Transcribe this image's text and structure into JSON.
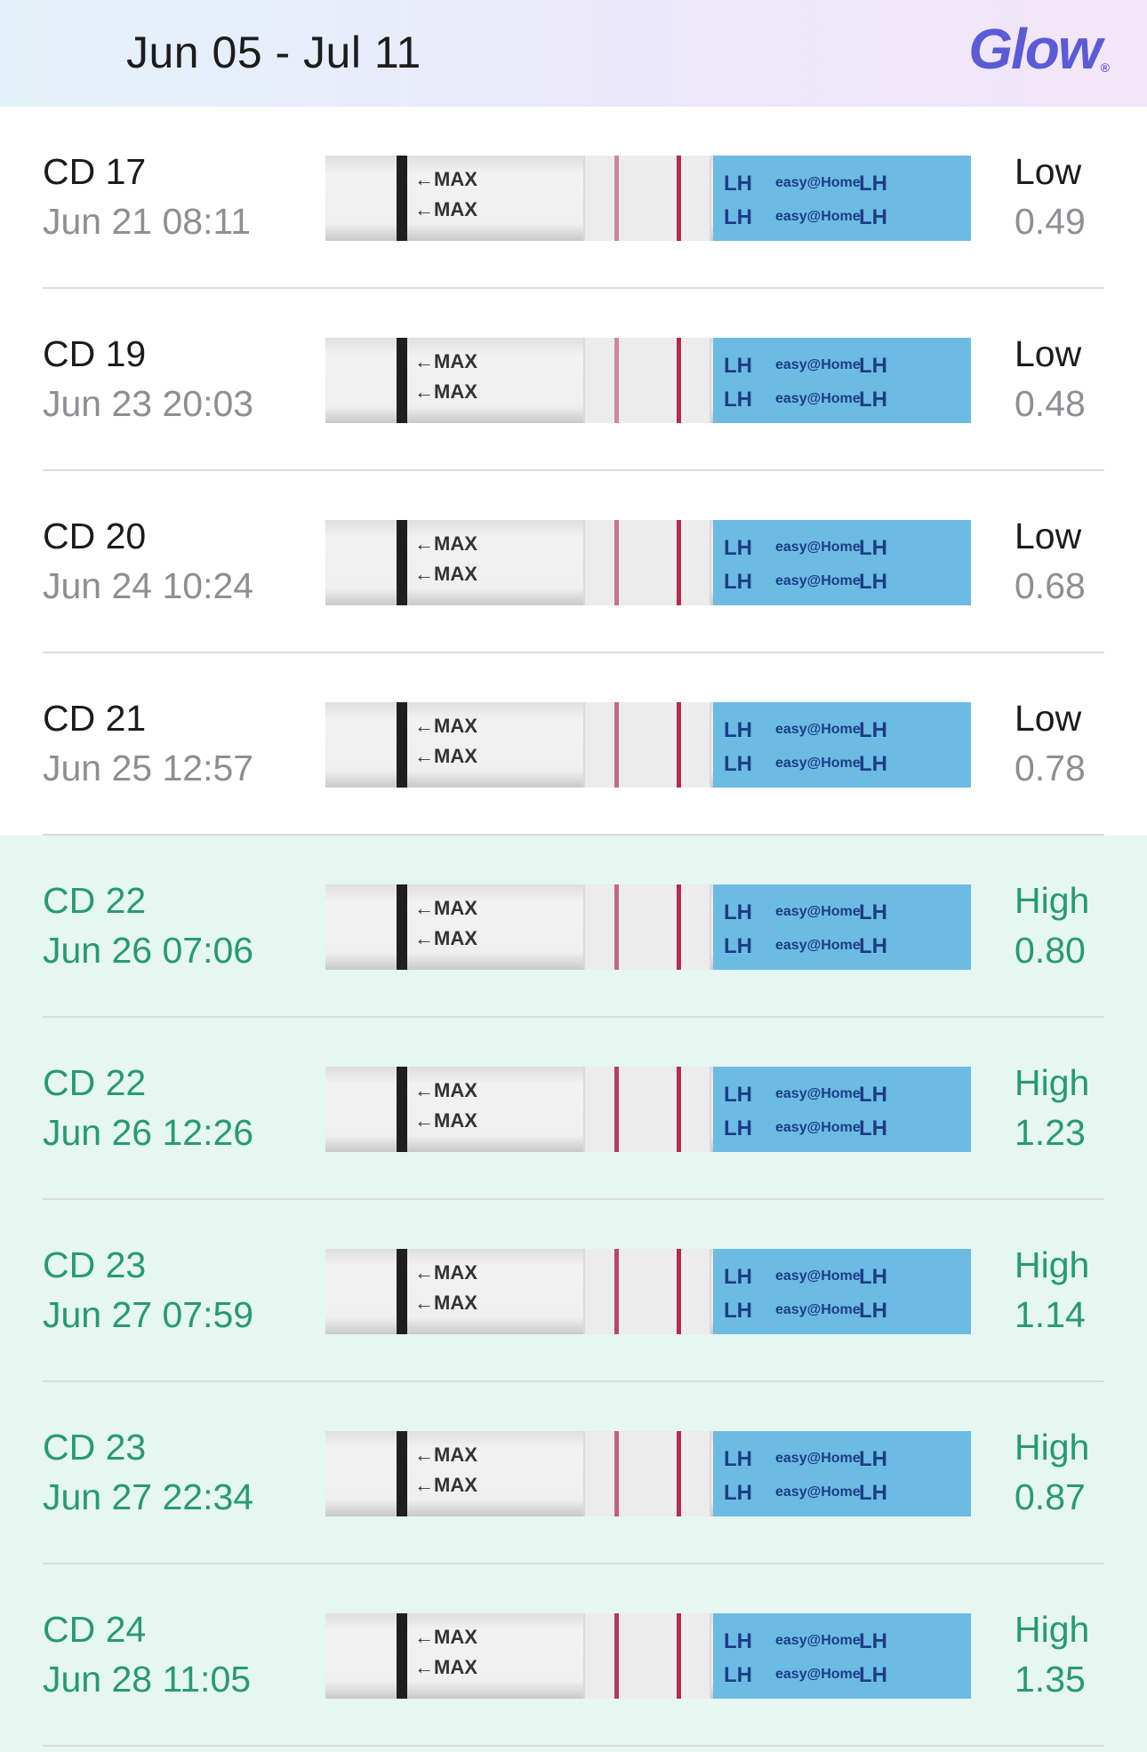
{
  "header": {
    "date_range": "Jun 05 - Jul 11",
    "brand": "Glow",
    "brand_mark": "®"
  },
  "strip_text": {
    "max": "←MAX",
    "lh": "LH",
    "brand_text": "easy@Home"
  },
  "colors": {
    "high_text": "#279a72",
    "low_label": "#1c1c1e",
    "muted": "#8e8e93",
    "high_background": "#e6f6f1",
    "brand": "#5b5bd6"
  },
  "tests": [
    {
      "cycle_day": "CD 17",
      "datetime": "Jun 21 08:11",
      "level": "Low",
      "value": "0.49"
    },
    {
      "cycle_day": "CD 19",
      "datetime": "Jun 23 20:03",
      "level": "Low",
      "value": "0.48"
    },
    {
      "cycle_day": "CD 20",
      "datetime": "Jun 24 10:24",
      "level": "Low",
      "value": "0.68"
    },
    {
      "cycle_day": "CD 21",
      "datetime": "Jun 25 12:57",
      "level": "Low",
      "value": "0.78"
    },
    {
      "cycle_day": "CD 22",
      "datetime": "Jun 26 07:06",
      "level": "High",
      "value": "0.80"
    },
    {
      "cycle_day": "CD 22",
      "datetime": "Jun 26 12:26",
      "level": "High",
      "value": "1.23"
    },
    {
      "cycle_day": "CD 23",
      "datetime": "Jun 27 07:59",
      "level": "High",
      "value": "1.14"
    },
    {
      "cycle_day": "CD 23",
      "datetime": "Jun 27 22:34",
      "level": "High",
      "value": "0.87"
    },
    {
      "cycle_day": "CD 24",
      "datetime": "Jun 28 11:05",
      "level": "High",
      "value": "1.35"
    }
  ]
}
